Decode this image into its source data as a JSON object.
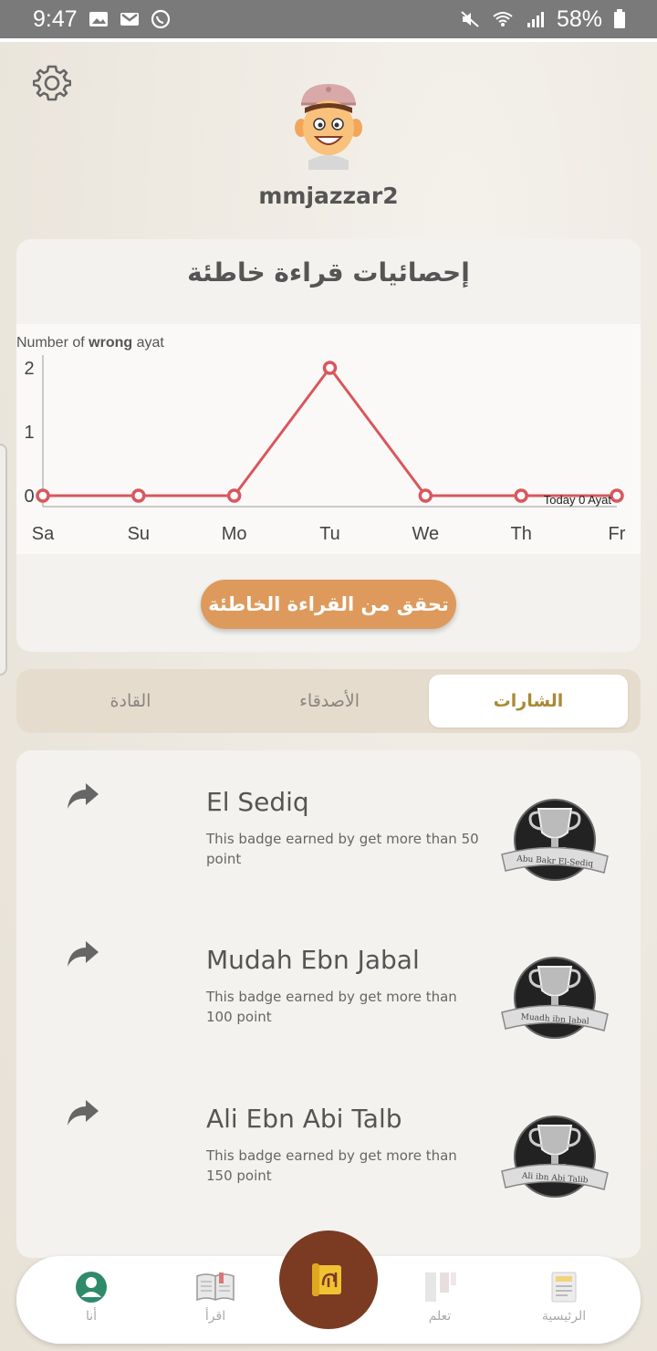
{
  "status_bar": {
    "time": "9:47",
    "battery": "58%",
    "icons": [
      "image-icon",
      "gmail-icon",
      "whatsapp-icon",
      "mute-icon",
      "wifi-icon",
      "signal-icon",
      "battery-icon"
    ]
  },
  "profile": {
    "username": "mmjazzar2"
  },
  "stats": {
    "title": "إحصائيات قراءة خاطئة",
    "ylabel_prefix": "Number of ",
    "ylabel_bold": "wrong",
    "ylabel_suffix": " ayat",
    "today_note": "Today 0 Ayat",
    "check_button": "تحقق من القراءة الخاطئة"
  },
  "chart_data": {
    "type": "line",
    "categories": [
      "Sa",
      "Su",
      "Mo",
      "Tu",
      "We",
      "Th",
      "Fr"
    ],
    "values": [
      0,
      0,
      0,
      2,
      0,
      0,
      0
    ],
    "ylabel": "Number of wrong ayat",
    "yticks": [
      0,
      1,
      2
    ],
    "ylim": [
      0,
      2
    ],
    "annotation": "Today 0 Ayat",
    "color": "#d9575d"
  },
  "tabs": {
    "items": [
      "الشارات",
      "الأصدقاء",
      "القادة"
    ],
    "active": "الشارات"
  },
  "badges": [
    {
      "name": "El Sediq",
      "description": "This badge earned by get more than 50 point",
      "ribbon": "Abu Bakr El-Sediq"
    },
    {
      "name": "Mudah Ebn Jabal",
      "description": "This badge earned by get more than 100 point",
      "ribbon": "Muadh ibn Jabal"
    },
    {
      "name": "Ali Ebn Abi Talb",
      "description": "This badge earned by get more than 150 point",
      "ribbon": "Ali ibn Abi Talib"
    }
  ],
  "bottom_nav": {
    "items": [
      {
        "label": "أنا",
        "icon": "profile-icon"
      },
      {
        "label": "اقرأ",
        "icon": "book-icon"
      },
      {
        "label": "",
        "icon": "scroll-icon"
      },
      {
        "label": "تعلم",
        "icon": "learn-icon"
      },
      {
        "label": "الرئيسية",
        "icon": "home-icon"
      }
    ]
  },
  "colors": {
    "accent_orange": "#dd9a5c",
    "tab_active_text": "#a98a35",
    "chart_line": "#d9575d",
    "center_nav_bg": "#7a3b22"
  }
}
